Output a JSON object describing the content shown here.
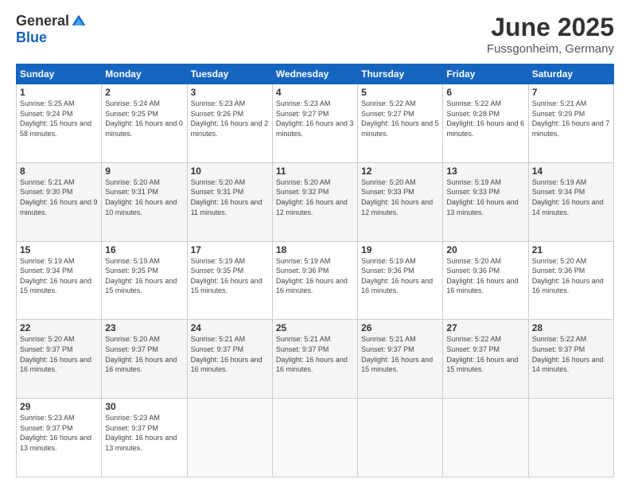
{
  "logo": {
    "general": "General",
    "blue": "Blue"
  },
  "header": {
    "title": "June 2025",
    "location": "Fussgonheim, Germany"
  },
  "days_of_week": [
    "Sunday",
    "Monday",
    "Tuesday",
    "Wednesday",
    "Thursday",
    "Friday",
    "Saturday"
  ],
  "weeks": [
    [
      {
        "day": "1",
        "sunrise": "5:25 AM",
        "sunset": "9:24 PM",
        "daylight": "15 hours and 58 minutes."
      },
      {
        "day": "2",
        "sunrise": "5:24 AM",
        "sunset": "9:25 PM",
        "daylight": "16 hours and 0 minutes."
      },
      {
        "day": "3",
        "sunrise": "5:23 AM",
        "sunset": "9:26 PM",
        "daylight": "16 hours and 2 minutes."
      },
      {
        "day": "4",
        "sunrise": "5:23 AM",
        "sunset": "9:27 PM",
        "daylight": "16 hours and 3 minutes."
      },
      {
        "day": "5",
        "sunrise": "5:22 AM",
        "sunset": "9:27 PM",
        "daylight": "16 hours and 5 minutes."
      },
      {
        "day": "6",
        "sunrise": "5:22 AM",
        "sunset": "9:28 PM",
        "daylight": "16 hours and 6 minutes."
      },
      {
        "day": "7",
        "sunrise": "5:21 AM",
        "sunset": "9:29 PM",
        "daylight": "16 hours and 7 minutes."
      }
    ],
    [
      {
        "day": "8",
        "sunrise": "5:21 AM",
        "sunset": "9:30 PM",
        "daylight": "16 hours and 9 minutes."
      },
      {
        "day": "9",
        "sunrise": "5:20 AM",
        "sunset": "9:31 PM",
        "daylight": "16 hours and 10 minutes."
      },
      {
        "day": "10",
        "sunrise": "5:20 AM",
        "sunset": "9:31 PM",
        "daylight": "16 hours and 11 minutes."
      },
      {
        "day": "11",
        "sunrise": "5:20 AM",
        "sunset": "9:32 PM",
        "daylight": "16 hours and 12 minutes."
      },
      {
        "day": "12",
        "sunrise": "5:20 AM",
        "sunset": "9:33 PM",
        "daylight": "16 hours and 12 minutes."
      },
      {
        "day": "13",
        "sunrise": "5:19 AM",
        "sunset": "9:33 PM",
        "daylight": "16 hours and 13 minutes."
      },
      {
        "day": "14",
        "sunrise": "5:19 AM",
        "sunset": "9:34 PM",
        "daylight": "16 hours and 14 minutes."
      }
    ],
    [
      {
        "day": "15",
        "sunrise": "5:19 AM",
        "sunset": "9:34 PM",
        "daylight": "16 hours and 15 minutes."
      },
      {
        "day": "16",
        "sunrise": "5:19 AM",
        "sunset": "9:35 PM",
        "daylight": "16 hours and 15 minutes."
      },
      {
        "day": "17",
        "sunrise": "5:19 AM",
        "sunset": "9:35 PM",
        "daylight": "16 hours and 15 minutes."
      },
      {
        "day": "18",
        "sunrise": "5:19 AM",
        "sunset": "9:36 PM",
        "daylight": "16 hours and 16 minutes."
      },
      {
        "day": "19",
        "sunrise": "5:19 AM",
        "sunset": "9:36 PM",
        "daylight": "16 hours and 16 minutes."
      },
      {
        "day": "20",
        "sunrise": "5:20 AM",
        "sunset": "9:36 PM",
        "daylight": "16 hours and 16 minutes."
      },
      {
        "day": "21",
        "sunrise": "5:20 AM",
        "sunset": "9:36 PM",
        "daylight": "16 hours and 16 minutes."
      }
    ],
    [
      {
        "day": "22",
        "sunrise": "5:20 AM",
        "sunset": "9:37 PM",
        "daylight": "16 hours and 16 minutes."
      },
      {
        "day": "23",
        "sunrise": "5:20 AM",
        "sunset": "9:37 PM",
        "daylight": "16 hours and 16 minutes."
      },
      {
        "day": "24",
        "sunrise": "5:21 AM",
        "sunset": "9:37 PM",
        "daylight": "16 hours and 16 minutes."
      },
      {
        "day": "25",
        "sunrise": "5:21 AM",
        "sunset": "9:37 PM",
        "daylight": "16 hours and 16 minutes."
      },
      {
        "day": "26",
        "sunrise": "5:21 AM",
        "sunset": "9:37 PM",
        "daylight": "16 hours and 15 minutes."
      },
      {
        "day": "27",
        "sunrise": "5:22 AM",
        "sunset": "9:37 PM",
        "daylight": "16 hours and 15 minutes."
      },
      {
        "day": "28",
        "sunrise": "5:22 AM",
        "sunset": "9:37 PM",
        "daylight": "16 hours and 14 minutes."
      }
    ],
    [
      {
        "day": "29",
        "sunrise": "5:23 AM",
        "sunset": "9:37 PM",
        "daylight": "16 hours and 13 minutes."
      },
      {
        "day": "30",
        "sunrise": "5:23 AM",
        "sunset": "9:37 PM",
        "daylight": "16 hours and 13 minutes."
      },
      null,
      null,
      null,
      null,
      null
    ]
  ]
}
